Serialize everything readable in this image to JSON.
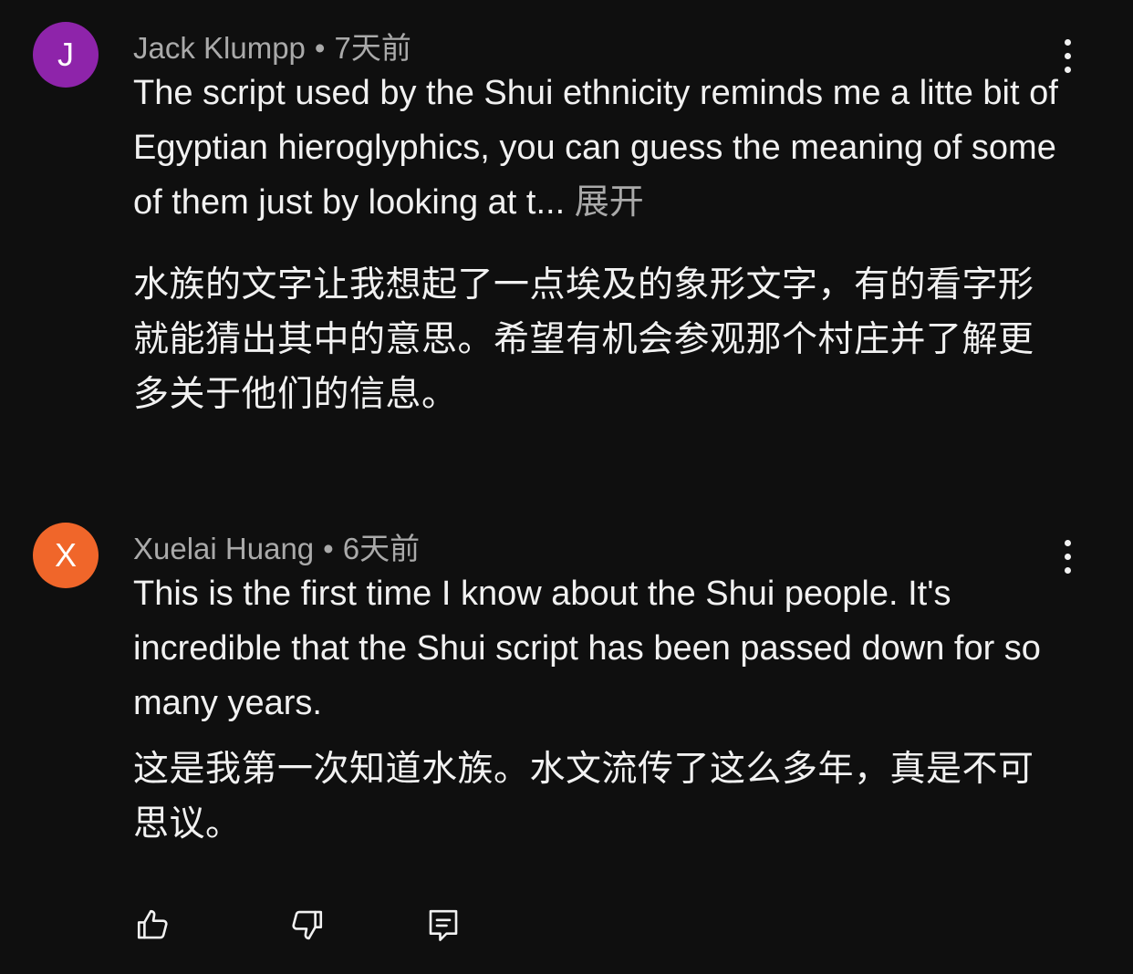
{
  "comments": [
    {
      "avatar_letter": "J",
      "avatar_color": "#8e24aa",
      "author": "Jack Klumpp",
      "separator": "•",
      "time": "7天前",
      "text": "The script used by the Shui ethnicity reminds me a litte bit of Egyptian hieroglyphics, you can guess the meaning of some of them just by looking at t...",
      "expand_label": "展开",
      "translation": "水族的文字让我想起了一点埃及的象形文字，有的看字形就能猜出其中的意思。希望有机会参观那个村庄并了解更多关于他们的信息。"
    },
    {
      "avatar_letter": "X",
      "avatar_color": "#f0662a",
      "author": "Xuelai Huang",
      "separator": "•",
      "time": "6天前",
      "text": "This is the first time I know about the Shui people. It's incredible that the Shui script has been passed down for so many years.",
      "translation": "这是我第一次知道水族。水文流传了这么多年，真是不可思议。"
    }
  ],
  "actions": {
    "like_icon": "thumbs-up-icon",
    "dislike_icon": "thumbs-down-icon",
    "reply_icon": "reply-icon"
  }
}
